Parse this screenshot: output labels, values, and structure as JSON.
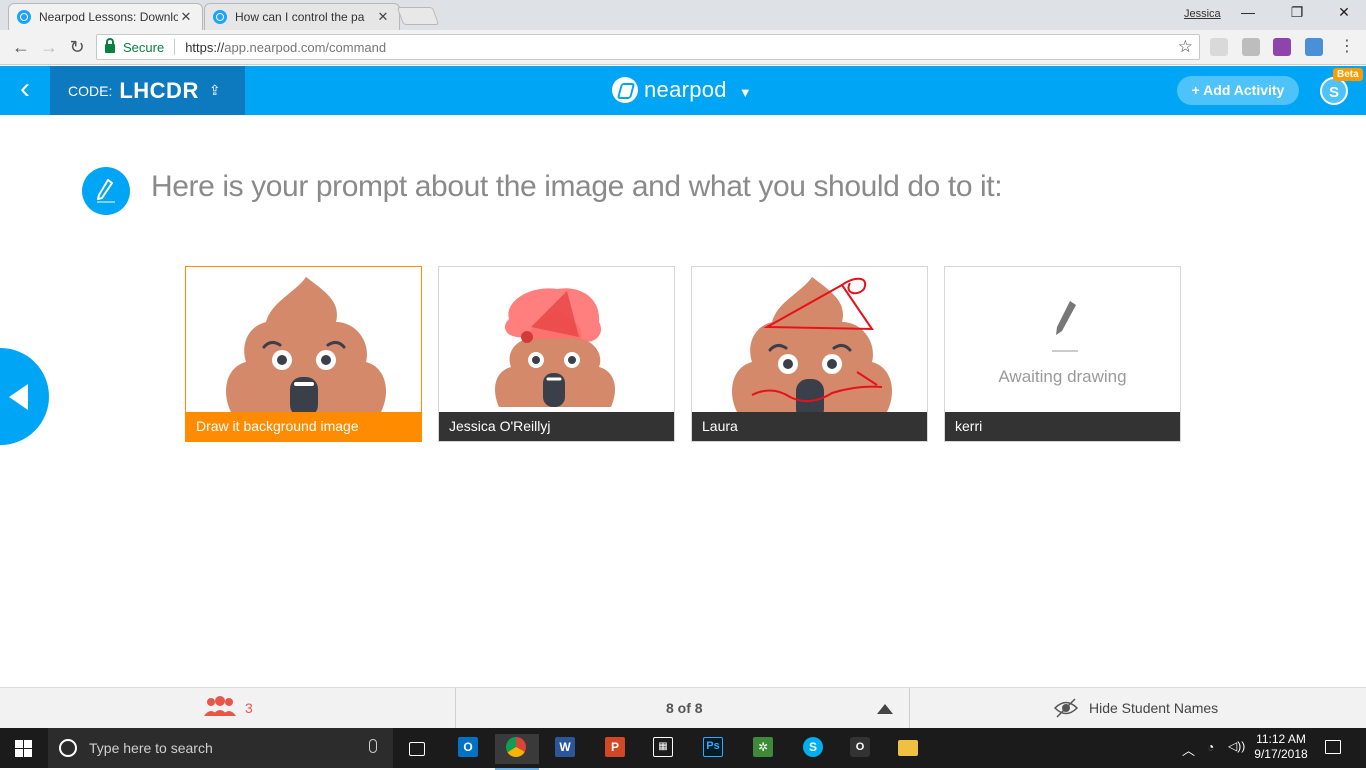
{
  "browser": {
    "tabs": [
      {
        "title": "Nearpod Lessons: Downlo",
        "active": true
      },
      {
        "title": "How can I control the pa",
        "active": false
      }
    ],
    "profile_name": "Jessica",
    "secure_label": "Secure",
    "url_scheme": "https://",
    "url_rest": "app.nearpod.com/command"
  },
  "header": {
    "code_label": "CODE:",
    "code_value": "LHCDR",
    "logo_text": "nearpod",
    "add_activity_label": "+ Add Activity",
    "avatar_letter": "S",
    "beta_label": "Beta",
    "accent_color": "#00a5f5",
    "code_box_color": "#0d7ac0"
  },
  "prompt": {
    "text": "Here is your prompt about the image and what you should do to it:",
    "icon": "pencil-icon"
  },
  "cards": [
    {
      "label": "Draw it background image",
      "type": "teacher"
    },
    {
      "label": "Jessica O'Reillyj",
      "type": "drawing-hair"
    },
    {
      "label": "Laura",
      "type": "drawing-hat"
    },
    {
      "label": "kerri",
      "type": "awaiting",
      "status": "Awaiting drawing"
    }
  ],
  "bottom_bar": {
    "students_count": "3",
    "slide_counter": "8 of 8",
    "hide_names_label": "Hide Student Names"
  },
  "taskbar": {
    "search_placeholder": "Type here to search",
    "time": "11:12 AM",
    "date": "9/17/2018",
    "apps": [
      "outlook-icon",
      "chrome-icon",
      "word-icon",
      "powerpoint-icon",
      "calculator-icon",
      "photoshop-icon",
      "network-app-icon",
      "skype-icon",
      "obs-icon",
      "file-explorer-icon"
    ]
  }
}
